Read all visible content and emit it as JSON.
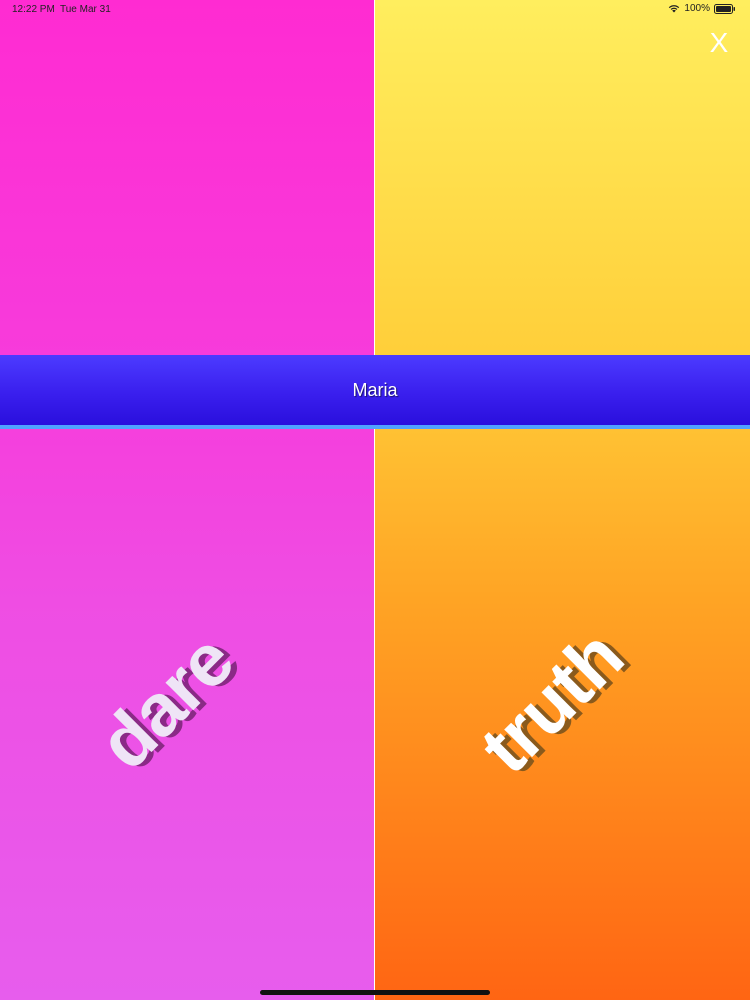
{
  "status_bar": {
    "time": "12:22 PM",
    "date": "Tue Mar 31",
    "battery": "100%",
    "icons": [
      "wifi-icon",
      "battery-icon"
    ]
  },
  "close_button": {
    "label": "X"
  },
  "player": {
    "name": "Maria"
  },
  "choices": {
    "dare": "dare",
    "truth": "truth"
  },
  "colors": {
    "dare_panel": "#ff2bd2",
    "truth_panel": "#ffee5e",
    "banner": "#3a1fee",
    "banner_border": "#4fa3ff"
  }
}
